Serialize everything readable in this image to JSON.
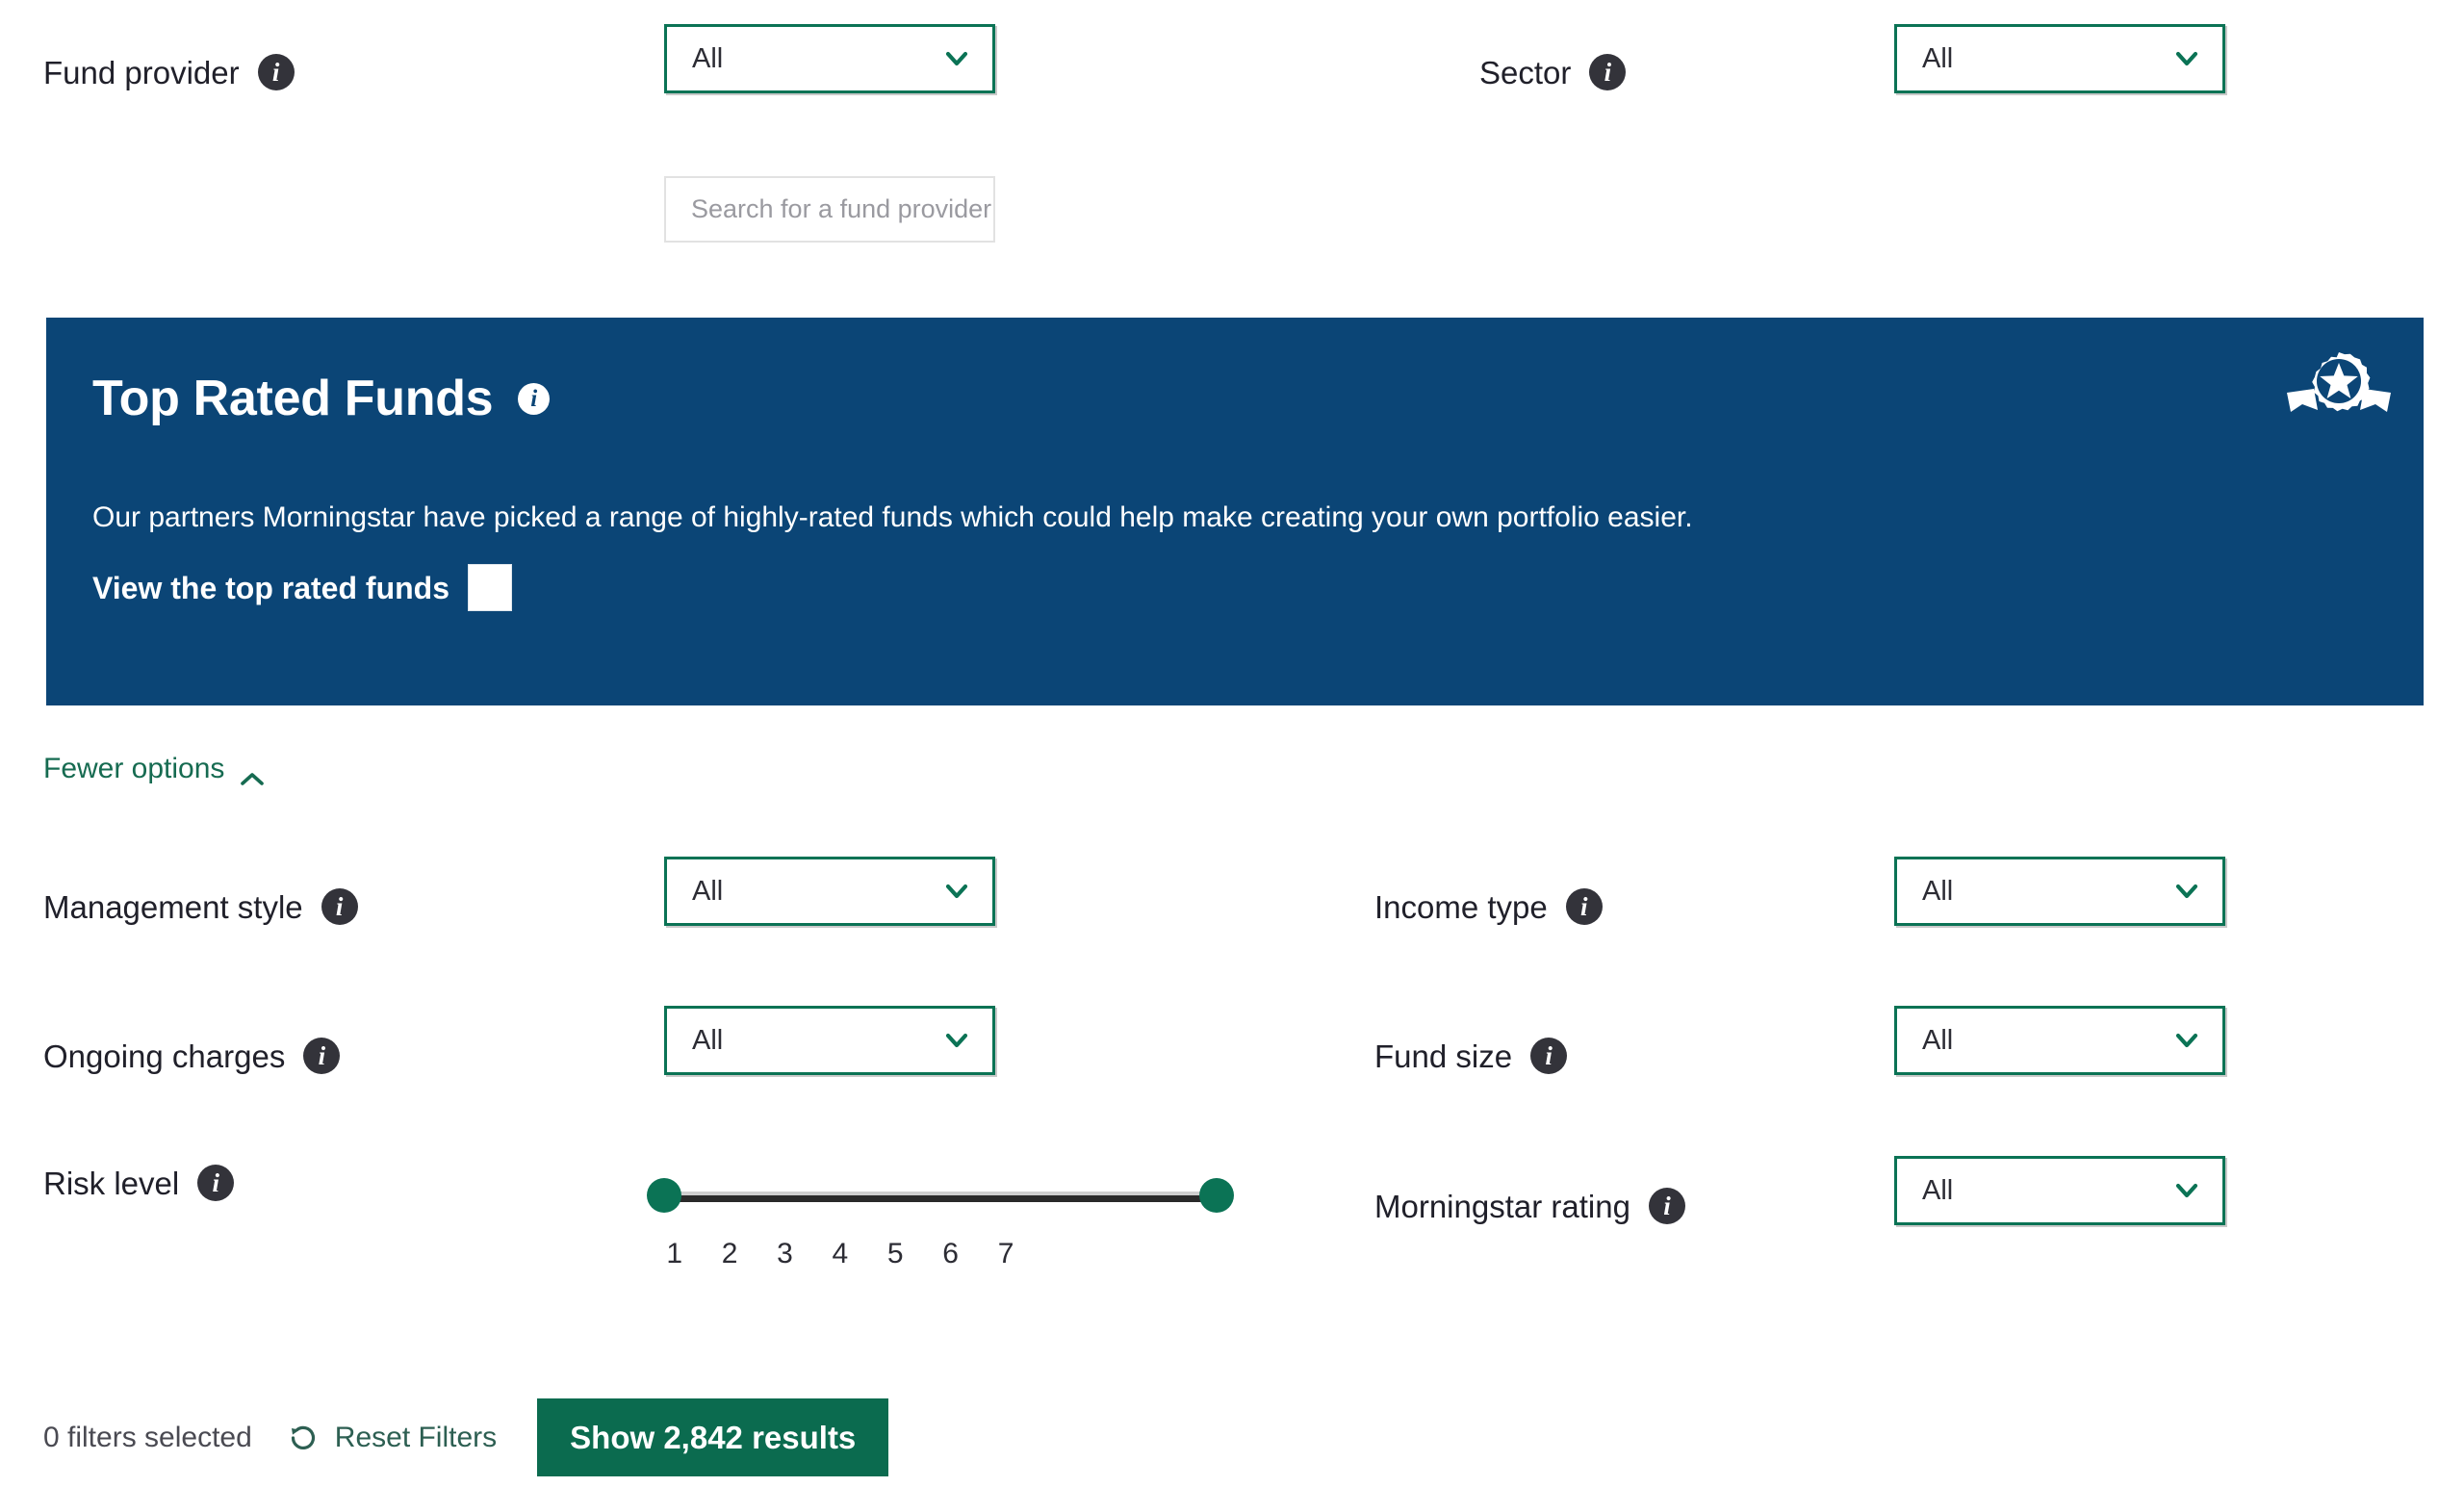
{
  "filters": {
    "fund_provider": {
      "label": "Fund provider",
      "info_icon": "info-icon",
      "value": "All",
      "search_placeholder": "Search for a fund provider"
    },
    "sector": {
      "label": "Sector",
      "info_icon": "info-icon",
      "value": "All"
    },
    "management_style": {
      "label": "Management style",
      "info_icon": "info-icon",
      "value": "All"
    },
    "income_type": {
      "label": "Income type",
      "info_icon": "info-icon",
      "value": "All"
    },
    "ongoing_charges": {
      "label": "Ongoing charges",
      "info_icon": "info-icon",
      "value": "All"
    },
    "fund_size": {
      "label": "Fund size",
      "info_icon": "info-icon",
      "value": "All"
    },
    "risk_level": {
      "label": "Risk level",
      "info_icon": "info-icon",
      "ticks": [
        "1",
        "2",
        "3",
        "4",
        "5",
        "6",
        "7"
      ],
      "min_selected": "1",
      "max_selected": "7"
    },
    "morningstar_rating": {
      "label": "Morningstar rating",
      "info_icon": "info-icon",
      "value": "All"
    }
  },
  "banner": {
    "title": "Top Rated Funds",
    "info_icon": "info-icon",
    "medal_icon": "rosette-medal-icon",
    "description": "Our partners Morningstar have picked a range of highly-rated funds which could help make creating your own portfolio easier.",
    "cta_label": "View the top rated funds",
    "toggle_state": "unchecked",
    "background_color": "#0b4576"
  },
  "toggle_options": {
    "label": "Fewer options",
    "chevron_icon": "chevron-up-icon"
  },
  "footer": {
    "filters_selected": "0 filters selected",
    "reset_label": "Reset Filters",
    "reset_icon": "reset-circular-arrow-icon",
    "show_results_label": "Show 2,842 results"
  },
  "icons": {
    "chevron_down": "chevron-down-icon"
  },
  "colors": {
    "accent_green": "#0b7355",
    "button_green": "#0b6b4f",
    "banner_blue": "#0b4576",
    "link_green": "#166b51"
  }
}
